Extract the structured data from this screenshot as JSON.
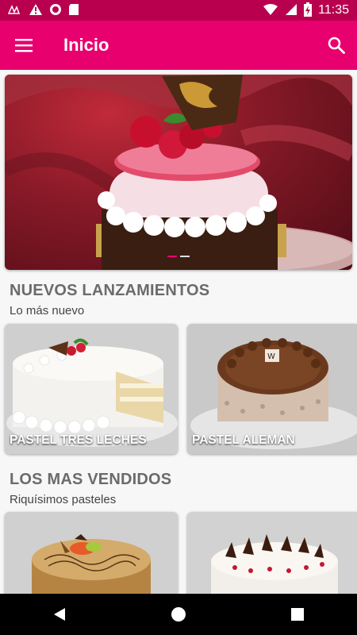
{
  "status_bar": {
    "time": "11:35",
    "icons": [
      "notification-icon",
      "warning-icon",
      "record-icon",
      "sd-card-icon",
      "wifi-icon",
      "signal-icon",
      "battery-charging-icon"
    ]
  },
  "app_bar": {
    "title": "Inicio",
    "menu_icon": "menu-icon",
    "search_icon": "search-icon",
    "color": "#e8006f",
    "status_color": "#b8004f"
  },
  "hero": {
    "slides": 2,
    "active_slide": 1
  },
  "sections": [
    {
      "title": "NUEVOS LANZAMIENTOS",
      "subtitle": "Lo más nuevo",
      "items": [
        {
          "label": "PASTEL TRES LECHES"
        },
        {
          "label": "PASTEL ALEMAN"
        }
      ]
    },
    {
      "title": "LOS MAS VENDIDOS",
      "subtitle": "Riquísimos pasteles",
      "items": [
        {
          "label": ""
        },
        {
          "label": ""
        }
      ]
    }
  ],
  "nav_bar": {
    "buttons": [
      "back-icon",
      "home-icon",
      "recents-icon"
    ]
  }
}
